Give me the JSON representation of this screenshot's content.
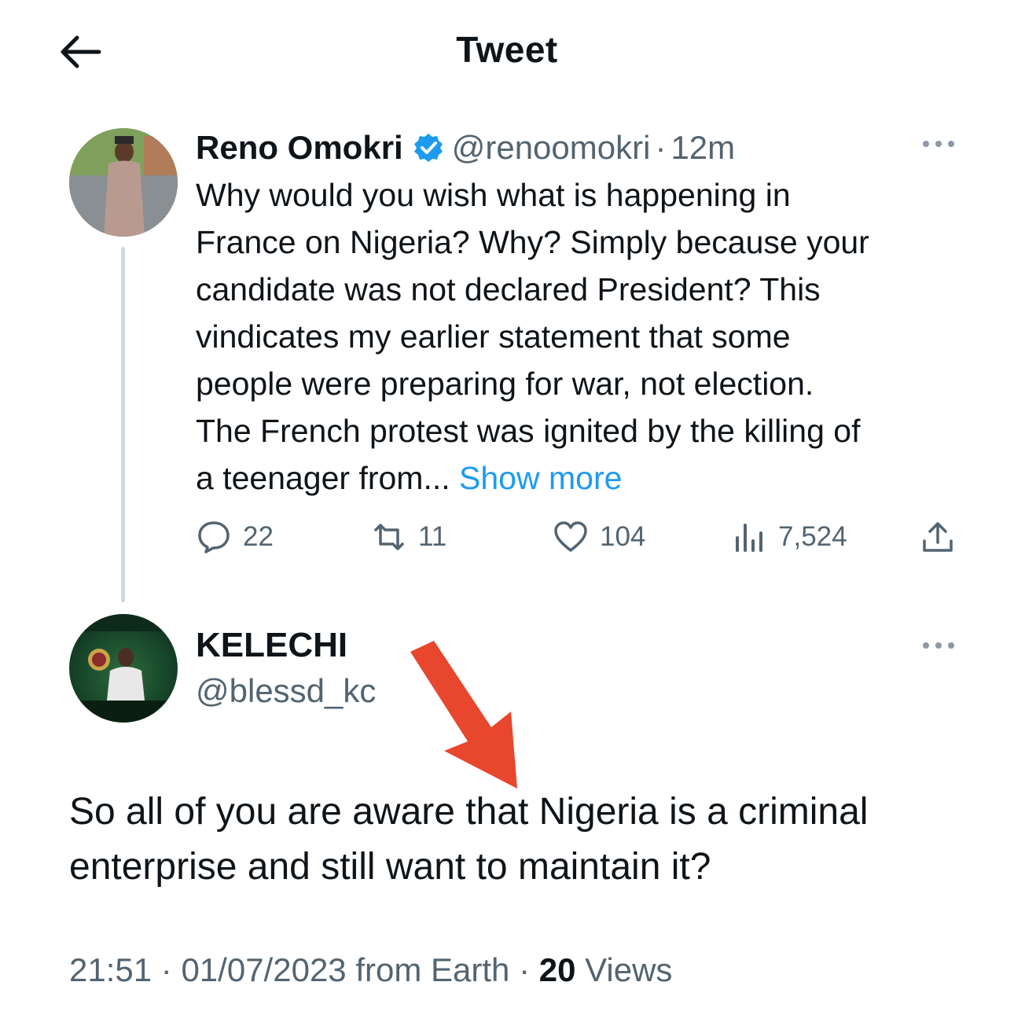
{
  "header": {
    "title": "Tweet",
    "back_icon": "arrow-left-icon"
  },
  "original_tweet": {
    "author_name": "Reno Omokri",
    "verified": true,
    "handle": "@renoomokri",
    "separator": "·",
    "time": "12m",
    "text_lines": [
      "Why would you wish what is happening in",
      "France on Nigeria? Why? Simply because your",
      "candidate was not declared President? This",
      "vindicates my earlier statement that some",
      "people were preparing for war, not election.",
      "The French protest was ignited by the killing of",
      "a teenager from..."
    ],
    "show_more": "Show more",
    "actions": {
      "replies": "22",
      "retweets": "11",
      "likes": "104",
      "views": "7,524"
    }
  },
  "reply": {
    "author_name": "KELECHI",
    "handle": "@blessd_kc",
    "text_lines": [
      "So all of you are aware that Nigeria is a criminal",
      "enterprise and still want to maintain it?"
    ],
    "time": "21:51",
    "date": "01/07/2023",
    "source": "from Earth",
    "separator": "·",
    "views_count": "20",
    "views_label": "Views"
  },
  "colors": {
    "accent": "#1d9bf0",
    "muted": "#536471",
    "text": "#0f1419",
    "annotation_arrow": "#e8462d"
  }
}
